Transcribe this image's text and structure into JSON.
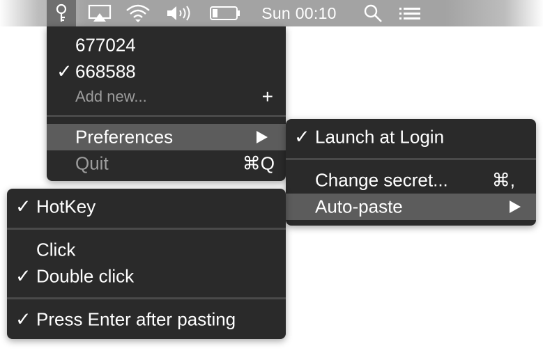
{
  "menubar": {
    "icons": [
      "key-icon",
      "airplay-icon",
      "wifi-icon",
      "volume-icon",
      "battery-icon",
      "search-icon",
      "list-icon"
    ],
    "clock": "Sun 00:10"
  },
  "main_menu": {
    "accounts": [
      {
        "label": "677024",
        "checked": false
      },
      {
        "label": "668588",
        "checked": true
      }
    ],
    "add_new": {
      "label": "Add new...",
      "shortcut": "+"
    },
    "preferences": {
      "label": "Preferences"
    },
    "quit": {
      "label": "Quit",
      "shortcut": "⌘Q"
    }
  },
  "preferences_menu": {
    "launch_at_login": "Launch at Login",
    "change_secret": {
      "label": "Change secret...",
      "shortcut": "⌘,"
    },
    "auto_paste": "Auto-paste"
  },
  "autopaste_menu": {
    "hotkey": "HotKey",
    "click": "Click",
    "double_click": "Double click",
    "press_enter": "Press Enter after pasting"
  },
  "check_mark": "✓"
}
